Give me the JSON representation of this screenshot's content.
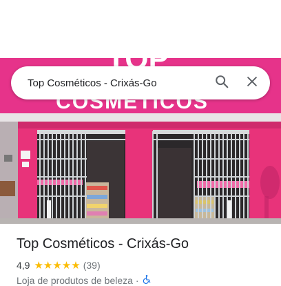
{
  "search": {
    "value": "Top Cosméticos - Crixás-Go"
  },
  "storefront": {
    "sign_top": "TOP",
    "sign_bottom": "COSMÉTICOS"
  },
  "place": {
    "title": "Top Cosméticos - Crixás-Go",
    "rating": "4,9",
    "stars": "★★★★★",
    "reviews": "(39)",
    "category": "Loja de produtos de beleza",
    "separator": "·"
  },
  "icons": {
    "search": "search-icon",
    "close": "close-icon",
    "accessibility": "wheelchair-icon"
  },
  "colors": {
    "facade_pink": "#e8337a",
    "star_yellow": "#fbbc04",
    "accessibility_blue": "#1a73e8"
  }
}
